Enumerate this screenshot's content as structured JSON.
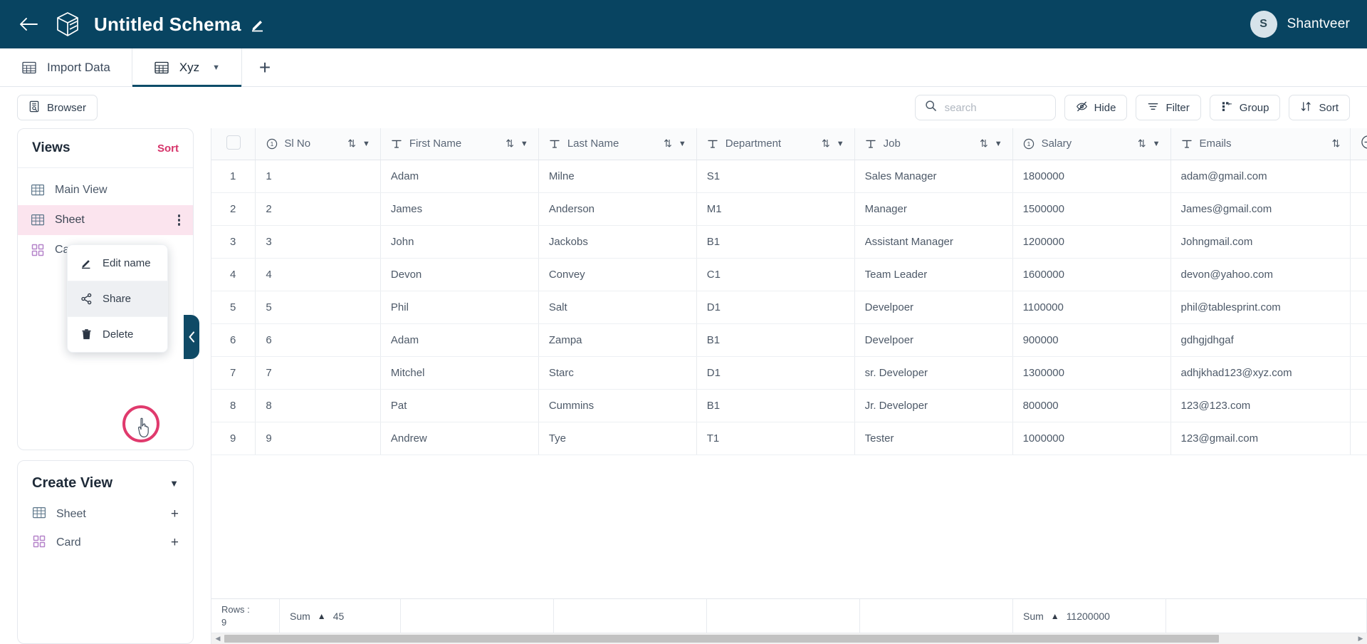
{
  "header": {
    "back_icon": "arrow-left-icon",
    "logo_icon": "cube-logo-icon",
    "title": "Untitled Schema",
    "edit_icon": "pencil-icon",
    "user": {
      "initial": "S",
      "name": "Shantveer"
    }
  },
  "tabs": {
    "items": [
      {
        "label": "Import Data",
        "icon": "table-icon",
        "active": false,
        "has_caret": false
      },
      {
        "label": "Xyz",
        "icon": "table-icon",
        "active": true,
        "has_caret": true
      }
    ],
    "add_label": "+"
  },
  "toolbar": {
    "browser_label": "Browser",
    "browser_icon": "browser-icon",
    "search": {
      "placeholder": "search",
      "value": "",
      "icon": "search-icon"
    },
    "buttons": [
      {
        "label": "Hide",
        "icon": "eye-off-icon"
      },
      {
        "label": "Filter",
        "icon": "filter-icon"
      },
      {
        "label": "Group",
        "icon": "group-icon"
      },
      {
        "label": "Sort",
        "icon": "sort-icon"
      }
    ]
  },
  "sidebar": {
    "views": {
      "title": "Views",
      "sort_label": "Sort",
      "items": [
        {
          "label": "Main View",
          "icon": "sheet-icon",
          "selected": false
        },
        {
          "label": "Sheet",
          "icon": "sheet-icon",
          "selected": true
        },
        {
          "label": "Card",
          "icon": "card-icon",
          "selected": false
        }
      ]
    },
    "context_menu": {
      "items": [
        {
          "label": "Edit name",
          "icon": "pencil-icon",
          "hover": false
        },
        {
          "label": "Share",
          "icon": "share-icon",
          "hover": true
        },
        {
          "label": "Delete",
          "icon": "trash-icon",
          "hover": false
        }
      ]
    },
    "create_view": {
      "title": "Create View",
      "chevron_icon": "chevron-down-icon",
      "items": [
        {
          "label": "Sheet",
          "icon": "sheet-icon",
          "add": "+"
        },
        {
          "label": "Card",
          "icon": "card-icon",
          "add": "+"
        }
      ]
    },
    "collapse_icon": "chevron-left-icon"
  },
  "grid": {
    "select_all_checkbox": false,
    "add_column_icon": "plus-circle-icon",
    "columns": [
      {
        "label": "Sl No",
        "type_icon": "number-icon",
        "sort_icon": "sort-updown-icon",
        "caret": true
      },
      {
        "label": "First Name",
        "type_icon": "text-icon",
        "sort_icon": "sort-updown-icon",
        "caret": true
      },
      {
        "label": "Last Name",
        "type_icon": "text-icon",
        "sort_icon": "sort-updown-icon",
        "caret": true
      },
      {
        "label": "Department",
        "type_icon": "text-icon",
        "sort_icon": "sort-updown-icon",
        "caret": true
      },
      {
        "label": "Job",
        "type_icon": "text-icon",
        "sort_icon": "sort-updown-icon",
        "caret": true
      },
      {
        "label": "Salary",
        "type_icon": "number-icon",
        "sort_icon": "sort-updown-icon",
        "caret": true
      },
      {
        "label": "Emails",
        "type_icon": "text-icon",
        "sort_icon": "sort-updown-icon",
        "caret": false
      }
    ],
    "rows": [
      {
        "n": "1",
        "cells": [
          "1",
          "Adam",
          "Milne",
          "S1",
          "Sales Manager",
          "1800000",
          "adam@gmail.com"
        ]
      },
      {
        "n": "2",
        "cells": [
          "2",
          "James",
          "Anderson",
          "M1",
          "Manager",
          "1500000",
          "James@gmail.com"
        ]
      },
      {
        "n": "3",
        "cells": [
          "3",
          "John",
          "Jackobs",
          "B1",
          "Assistant Manager",
          "1200000",
          "Johngmail.com"
        ]
      },
      {
        "n": "4",
        "cells": [
          "4",
          "Devon",
          "Convey",
          "C1",
          "Team Leader",
          "1600000",
          "devon@yahoo.com"
        ]
      },
      {
        "n": "5",
        "cells": [
          "5",
          "Phil",
          "Salt",
          "D1",
          "Develpoer",
          "1100000",
          "phil@tablesprint.com"
        ]
      },
      {
        "n": "6",
        "cells": [
          "6",
          "Adam",
          "Zampa",
          "B1",
          "Develpoer",
          "900000",
          "gdhgjdhgaf"
        ]
      },
      {
        "n": "7",
        "cells": [
          "7",
          "Mitchel",
          "Starc",
          "D1",
          "sr. Developer",
          "1300000",
          "adhjkhad123@xyz.com"
        ]
      },
      {
        "n": "8",
        "cells": [
          "8",
          "Pat",
          "Cummins",
          "B1",
          "Jr. Developer",
          "800000",
          "123@123.com"
        ]
      },
      {
        "n": "9",
        "cells": [
          "9",
          "Andrew",
          "Tye",
          "T1",
          "Tester",
          "1000000",
          "123@gmail.com"
        ]
      }
    ],
    "footer": {
      "rows_label": "Rows :",
      "rows_count": "9",
      "slno_sum_label": "Sum",
      "slno_sum_value": "45",
      "salary_sum_label": "Sum",
      "salary_sum_value": "11200000"
    }
  },
  "colors": {
    "header_bg": "#084461",
    "accent_pink": "#d6346a",
    "selected_row_bg": "#fbe4ee",
    "annotation": "#e03a6d"
  }
}
